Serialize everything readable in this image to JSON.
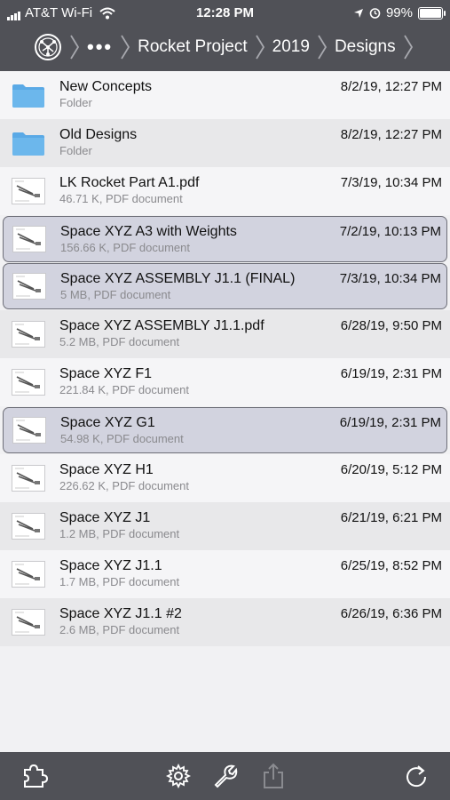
{
  "status": {
    "carrier": "AT&T Wi-Fi",
    "time": "12:28 PM",
    "battery": "99%",
    "battery_level": 0.99
  },
  "breadcrumb": {
    "root_icon": "network-globe-icon",
    "ellipsis": "•••",
    "items": [
      "Rocket Project",
      "2019",
      "Designs"
    ]
  },
  "files": [
    {
      "name": "New Concepts",
      "meta": "Folder",
      "date": "8/2/19, 12:27 PM",
      "kind": "folder",
      "selected": false
    },
    {
      "name": "Old Designs",
      "meta": "Folder",
      "date": "8/2/19, 12:27 PM",
      "kind": "folder",
      "selected": false
    },
    {
      "name": "LK Rocket Part A1.pdf",
      "meta": "46.71 K, PDF document",
      "date": "7/3/19, 10:34 PM",
      "kind": "pdf",
      "selected": false
    },
    {
      "name": "Space XYZ A3 with Weights",
      "meta": "156.66 K, PDF document",
      "date": "7/2/19, 10:13 PM",
      "kind": "pdf",
      "selected": true
    },
    {
      "name": "Space XYZ ASSEMBLY J1.1 (FINAL)",
      "meta": "5 MB, PDF document",
      "date": "7/3/19, 10:34 PM",
      "kind": "pdf",
      "selected": true
    },
    {
      "name": "Space XYZ ASSEMBLY J1.1.pdf",
      "meta": "5.2 MB, PDF document",
      "date": "6/28/19, 9:50 PM",
      "kind": "pdf",
      "selected": false
    },
    {
      "name": "Space XYZ F1",
      "meta": "221.84 K, PDF document",
      "date": "6/19/19, 2:31 PM",
      "kind": "pdf",
      "selected": false
    },
    {
      "name": "Space XYZ G1",
      "meta": "54.98 K, PDF document",
      "date": "6/19/19, 2:31 PM",
      "kind": "pdf",
      "selected": true
    },
    {
      "name": "Space XYZ H1",
      "meta": "226.62 K, PDF document",
      "date": "6/20/19, 5:12 PM",
      "kind": "pdf",
      "selected": false
    },
    {
      "name": "Space XYZ J1",
      "meta": "1.2 MB, PDF document",
      "date": "6/21/19, 6:21 PM",
      "kind": "pdf",
      "selected": false
    },
    {
      "name": "Space XYZ J1.1",
      "meta": "1.7 MB, PDF document",
      "date": "6/25/19, 8:52 PM",
      "kind": "pdf",
      "selected": false
    },
    {
      "name": "Space XYZ J1.1 #2",
      "meta": "2.6 MB, PDF document",
      "date": "6/26/19, 6:36 PM",
      "kind": "pdf",
      "selected": false
    }
  ],
  "toolbar": {
    "icons": [
      "puzzle-icon",
      "gear-icon",
      "wrench-icon",
      "share-icon",
      "refresh-icon"
    ]
  },
  "colors": {
    "bar": "#505157",
    "folder": "#5aa9e6",
    "selected_bg": "#d2d3df"
  }
}
